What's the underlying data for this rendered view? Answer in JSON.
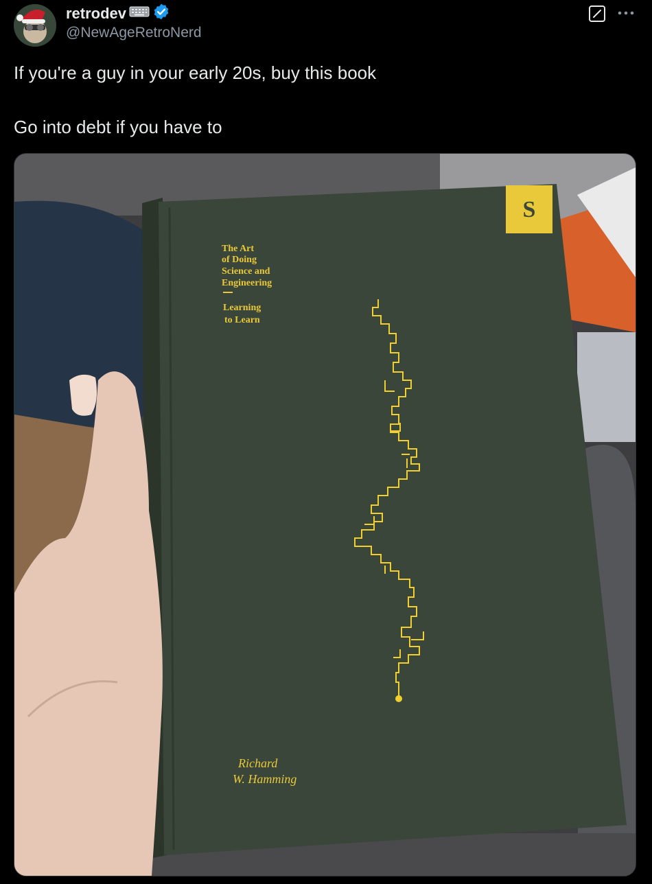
{
  "user": {
    "display_name": "retrodev",
    "handle": "@NewAgeRetroNerd",
    "verified": true,
    "badge_icon": "keyboard-icon",
    "verified_color": "#1d9bf0"
  },
  "tweet": {
    "line1": "If you're a guy in your early 20s, buy this book",
    "line2": "Go into debt if you have to"
  },
  "actions": {
    "grok_icon": "grok-icon",
    "more_icon": "more-icon"
  },
  "book": {
    "title_lines": [
      "The Art",
      "of Doing",
      "Science and",
      "Engineering"
    ],
    "subtitle_lines": [
      "Learning",
      "to Learn"
    ],
    "author_lines": [
      "Richard",
      "W. Hamming"
    ],
    "cover_color": "#3a4639",
    "accent_color": "#e9c93a"
  }
}
